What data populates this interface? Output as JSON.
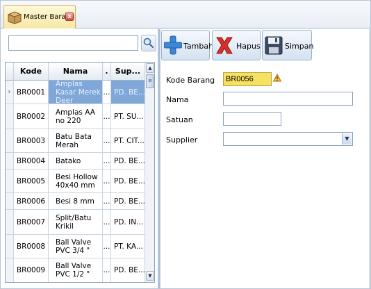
{
  "tab": {
    "label": "Master Barang",
    "close": "x"
  },
  "search": {
    "value": "",
    "placeholder": ""
  },
  "grid": {
    "columns": [
      "Kode",
      "Nama",
      ".",
      "Sup..."
    ],
    "rows": [
      {
        "kode": "BR0001",
        "nama": "Amplas Kasar Merek Deer",
        "dot": "...",
        "supplier": "PD. BE...",
        "selected": true
      },
      {
        "kode": "BR0002",
        "nama": "Amplas AA no 220",
        "dot": "...",
        "supplier": "PT. SU..."
      },
      {
        "kode": "BR0003",
        "nama": "Batu Bata Merah",
        "dot": "...",
        "supplier": "PT. CIT..."
      },
      {
        "kode": "BR0004",
        "nama": "Batako",
        "dot": "...",
        "supplier": "PD. BE..."
      },
      {
        "kode": "BR0005",
        "nama": "Besi Hollow 40x40 mm",
        "dot": "...",
        "supplier": "PD. BE..."
      },
      {
        "kode": "BR0006",
        "nama": "Besi 8 mm",
        "dot": "...",
        "supplier": "PD. BE..."
      },
      {
        "kode": "BR0007",
        "nama": "Split/Batu Krikil",
        "dot": "...",
        "supplier": "PD. IN..."
      },
      {
        "kode": "BR0008",
        "nama": "Ball Valve PVC 3/4 \"",
        "dot": "...",
        "supplier": "PT. KA..."
      },
      {
        "kode": "BR0009",
        "nama": "Ball Valve PVC 1/2 \"",
        "dot": "...",
        "supplier": "PD. BE..."
      }
    ]
  },
  "toolbar": {
    "tambah": "Tambah",
    "hapus": "Hapus",
    "simpan": "Simpan"
  },
  "form": {
    "kode_label": "Kode Barang",
    "kode_value": "BR0056",
    "nama_label": "Nama",
    "nama_value": "",
    "satuan_label": "Satuan",
    "satuan_value": "",
    "supplier_label": "Supplier",
    "supplier_value": ""
  },
  "colors": {
    "selected_row": "#7fa7d8",
    "required_field": "#f6e160",
    "tab_bg": "#f7e7a6"
  }
}
